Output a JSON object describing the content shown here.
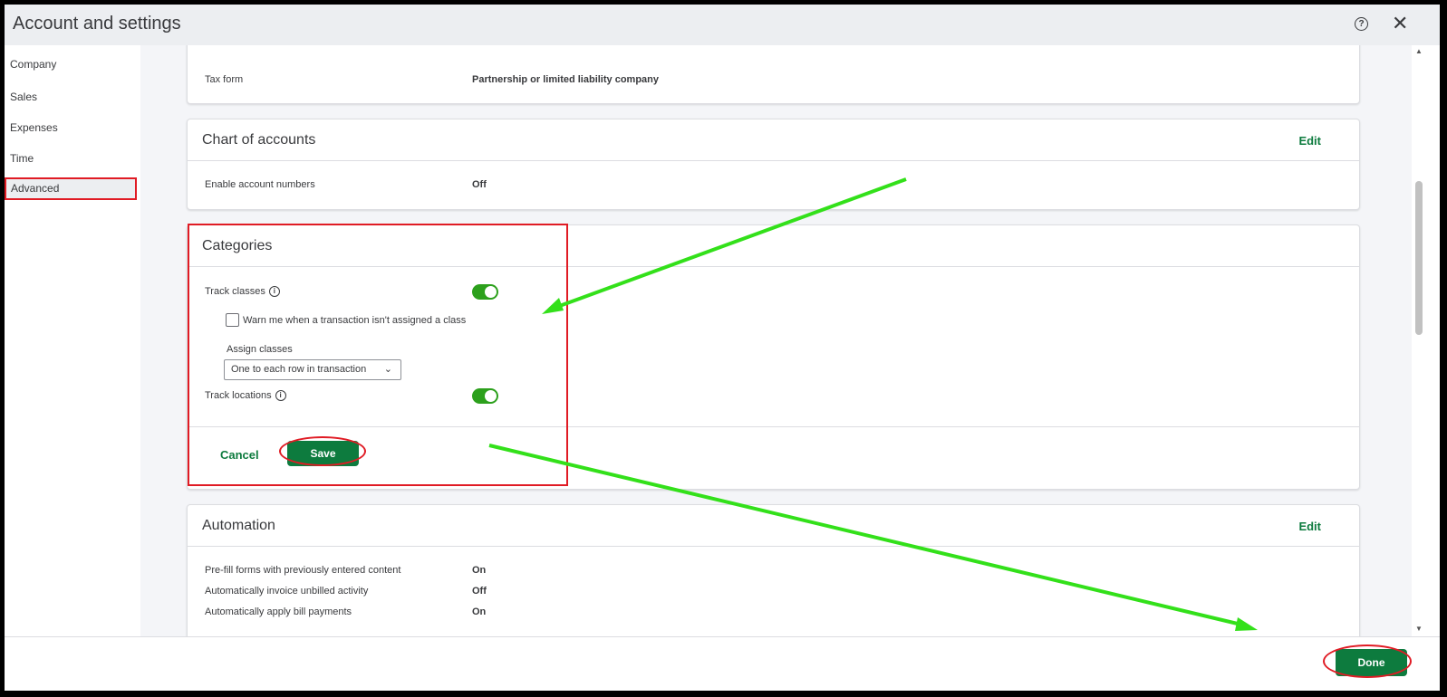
{
  "window": {
    "title": "Account and settings"
  },
  "sidebar": {
    "items": [
      {
        "label": "Company"
      },
      {
        "label": "Sales"
      },
      {
        "label": "Expenses"
      },
      {
        "label": "Time"
      },
      {
        "label": "Advanced"
      }
    ],
    "active": "Advanced"
  },
  "sections": {
    "company_type": {
      "tax_form_label": "Tax form",
      "tax_form_value": "Partnership or limited liability company"
    },
    "chart_of_accounts": {
      "title": "Chart of accounts",
      "edit_label": "Edit",
      "enable_account_numbers_label": "Enable account numbers",
      "enable_account_numbers_value": "Off"
    },
    "categories": {
      "title": "Categories",
      "track_classes_label": "Track classes",
      "track_classes_on": true,
      "warn_label": "Warn me when a transaction isn't assigned a class",
      "warn_checked": false,
      "assign_classes_label": "Assign classes",
      "assign_classes_value": "One to each row in transaction",
      "track_locations_label": "Track locations",
      "track_locations_on": true,
      "cancel_label": "Cancel",
      "save_label": "Save"
    },
    "automation": {
      "title": "Automation",
      "edit_label": "Edit",
      "rows": [
        {
          "label": "Pre-fill forms with previously entered content",
          "value": "On"
        },
        {
          "label": "Automatically invoice unbilled activity",
          "value": "Off"
        },
        {
          "label": "Automatically apply bill payments",
          "value": "On"
        }
      ]
    }
  },
  "footer": {
    "done_label": "Done"
  },
  "icons": {
    "help": "help-icon",
    "close": "close-icon",
    "info": "info-icon",
    "chevron": "chevron-down-icon"
  },
  "colors": {
    "accent_green": "#0d7b3e",
    "toggle_green": "#2ca01c",
    "annotation_red": "#e01b24",
    "annotation_arrow": "#33e01a"
  }
}
